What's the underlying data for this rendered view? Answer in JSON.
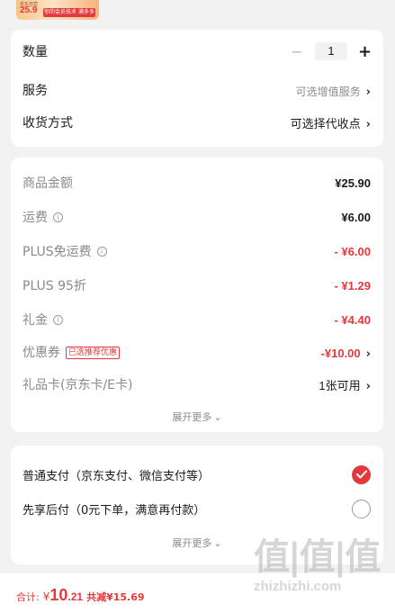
{
  "thumbnail": {
    "mini_text": "京东自营",
    "price": "25.9",
    "tag": "你的会员技术 满多多"
  },
  "options": {
    "quantity_label": "数量",
    "quantity_minus": "−",
    "quantity_value": "1",
    "quantity_plus": "+",
    "service_label": "服务",
    "service_hint": "可选增值服务",
    "delivery_label": "收货方式",
    "delivery_hint": "可选择代收点",
    "chevron": "›"
  },
  "fees": {
    "items": [
      {
        "label": "商品金额",
        "value": "¥25.90"
      },
      {
        "label": "运费",
        "value": "¥6.00"
      },
      {
        "label": "PLUS免运费",
        "value": "- ¥6.00"
      },
      {
        "label": "PLUS 95折",
        "value": "- ¥1.29"
      },
      {
        "label": "礼金",
        "value": "- ¥4.40"
      },
      {
        "label": "优惠券",
        "value": "-¥10.00",
        "badge": "已选推荐优惠"
      },
      {
        "label": "礼品卡(京东卡/E卡)",
        "value": "1张可用"
      }
    ],
    "info_glyph": "i",
    "expand_label": "展开更多",
    "expand_glyph": "⌄"
  },
  "payment": {
    "options": [
      {
        "label": "普通支付（京东支付、微信支付等）",
        "selected": true
      },
      {
        "label": "先享后付（0元下单，满意再付款）",
        "selected": false
      }
    ],
    "expand_label": "展开更多",
    "expand_glyph": "⌄"
  },
  "footer": {
    "total_label": "合计:",
    "yen": "¥",
    "total_int": "10",
    "total_dec": ".21",
    "saved": "共减¥15.69"
  },
  "watermark": {
    "main": "值|值|值",
    "sub": "zhizhizhi.com"
  },
  "colors": {
    "accent": "#e4393c",
    "background": "#f2f2f2",
    "card": "#ffffff"
  }
}
